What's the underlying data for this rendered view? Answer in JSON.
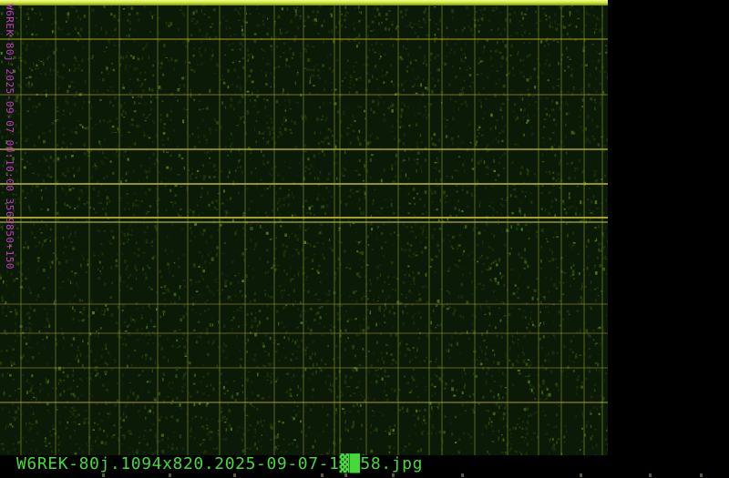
{
  "image": {
    "caption": "W6REK-80j.1094x820.2025-09-07-1▓█58.jpg",
    "side_label": "W6REK-80j 2025-09-07 00:10:00 3569850+150"
  },
  "colors": {
    "background": "#000000",
    "waterfall_base": "#0b1a06",
    "signal_green": "#5a8a18",
    "signal_yellow": "#b8b020",
    "top_band": "#f6ff8a",
    "side_label": "#c43cc8",
    "caption": "#46d93a"
  }
}
